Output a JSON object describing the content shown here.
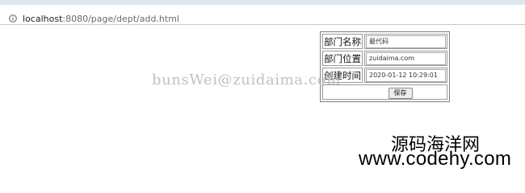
{
  "browser": {
    "url_host": "localhost",
    "url_rest": ":8080/page/dept/add.html"
  },
  "form": {
    "rows": [
      {
        "label": "部门名称",
        "value": "最代码"
      },
      {
        "label": "部门位置",
        "value": "zuidaima.com"
      },
      {
        "label": "创建时间",
        "value": "2020-01-12 10:29:01"
      }
    ],
    "save_label": "保存"
  },
  "watermark": "bunsWei@zuidaima.com",
  "brand": {
    "name": "源码海洋网",
    "url": "www.codehy.com"
  },
  "icons": {
    "info": "info-circle-icon"
  },
  "colors": {
    "watermark": "#c2c2c2",
    "border": "#9a9a9a"
  }
}
